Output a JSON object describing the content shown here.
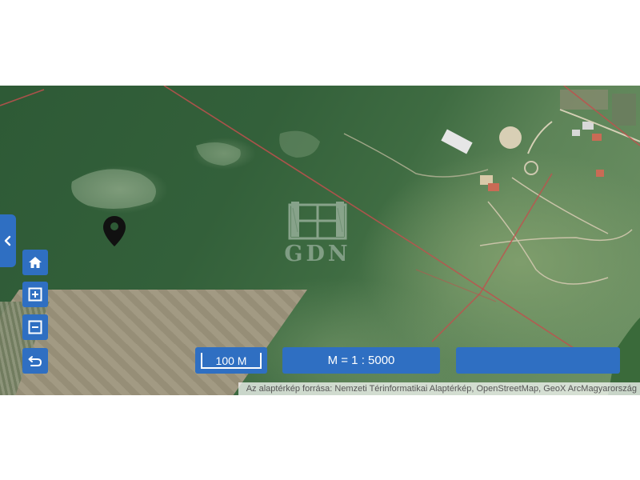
{
  "map": {
    "watermark": "GDN",
    "attribution": "Az alaptérkép forrása: Nemzeti Térinformatikai Alaptérkép, OpenStreetMap, GeoX ArcMagyarország"
  },
  "scale_bar": {
    "label": "100 M"
  },
  "scale_ratio": {
    "label": "M = 1 : 5000"
  },
  "status_bar": {
    "label": ""
  },
  "icons": {
    "side_toggle": "chevron-left-icon",
    "home": "home-icon",
    "zoom_in": "zoom-in-icon",
    "zoom_out": "zoom-out-icon",
    "back": "undo-arrow-icon",
    "marker": "map-pin-icon"
  },
  "colors": {
    "button": "#2f6fc2",
    "parcel_line": "#c0504d",
    "marker": "#111111"
  }
}
